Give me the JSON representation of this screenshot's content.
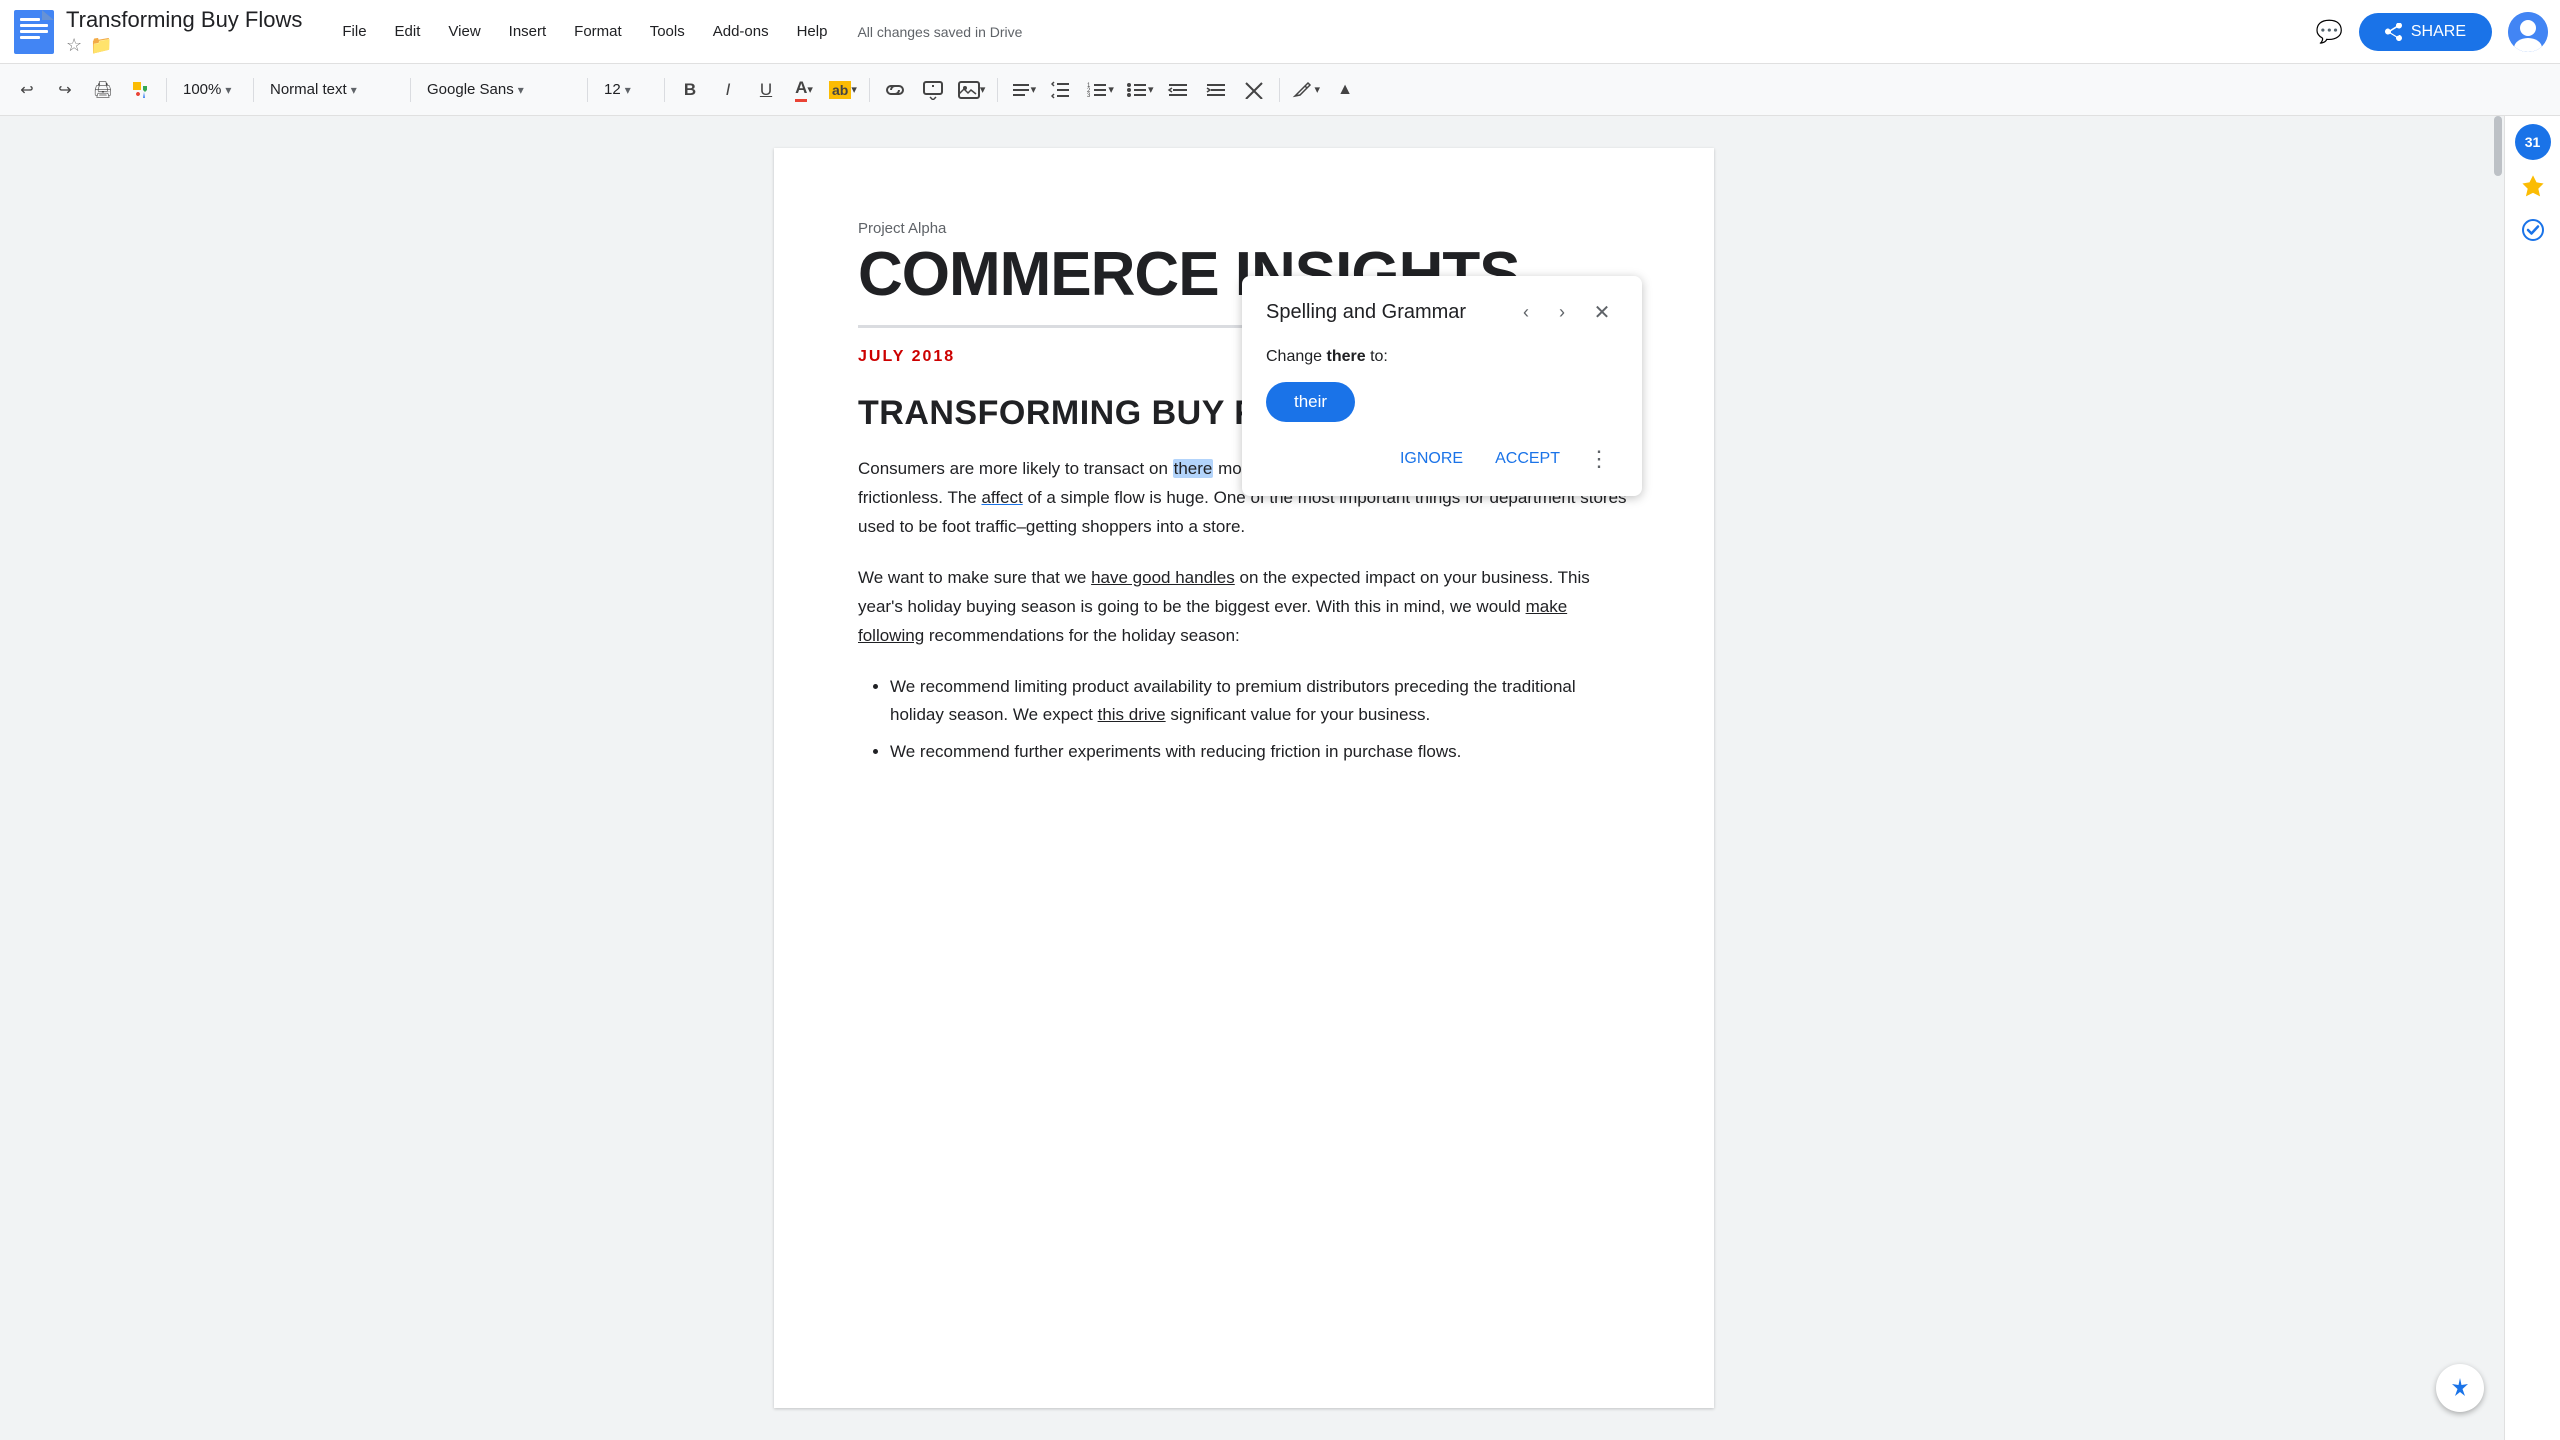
{
  "app": {
    "title": "Transforming Buy Flows",
    "autosave": "All changes saved in Drive"
  },
  "menu": {
    "items": [
      "File",
      "Edit",
      "View",
      "Insert",
      "Format",
      "Tools",
      "Add-ons",
      "Help"
    ]
  },
  "toolbar": {
    "zoom": "100%",
    "format": "Normal text",
    "font": "Google Sans",
    "fontSize": "12",
    "bold_label": "B",
    "italic_label": "I",
    "underline_label": "U"
  },
  "spelling_panel": {
    "title": "Spelling and Grammar",
    "change_prefix": "Change ",
    "original_word": "there",
    "change_suffix": " to:",
    "suggestion": "their",
    "ignore_label": "IGNORE",
    "accept_label": "ACCEPT"
  },
  "document": {
    "project_label": "Project Alpha",
    "main_title": "COMMERCE INSIGHTS",
    "date": "JULY 2018",
    "section_title": "TRANSFORMING BUY FLOWS",
    "paragraph1": "Consumers are more likely to transact on there mobile devices when online buying flows are frictionless. The affect of a simple flow is huge. One of the most important things for department stores used to be foot traffic–getting shoppers into a store.",
    "paragraph2": "We want to make sure that we have good handles on the expected impact on your business. This year's holiday buying season is going to be the biggest ever. With this in mind, we would make following recommendations for the holiday season:",
    "bullets": [
      "We recommend limiting product availability to premium distributors preceding the traditional holiday season. We expect this drive significant value for your business.",
      "We recommend further experiments with reducing friction in purchase flows."
    ]
  },
  "share_button": "SHARE",
  "icons": {
    "undo": "↩",
    "redo": "↪",
    "print": "🖨",
    "paint": "🎨",
    "comment": "💬",
    "star": "☆",
    "folder": "📁",
    "calendar": "31",
    "check": "✔",
    "fab": "✦"
  }
}
